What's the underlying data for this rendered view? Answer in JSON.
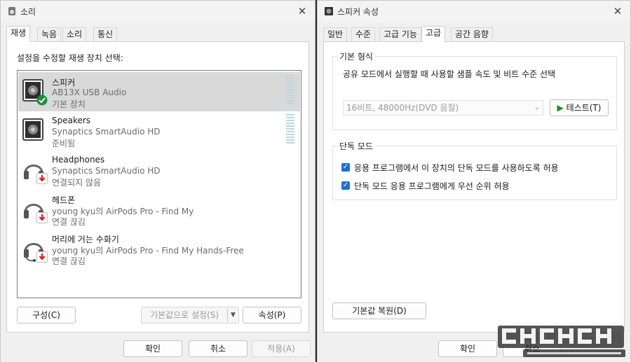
{
  "left_window": {
    "title": "소리",
    "close_glyph": "✕",
    "tabs": [
      "재생",
      "녹음",
      "소리",
      "통신"
    ],
    "active_tab": "재생",
    "prompt": "설정을 수정할 재생 장치 선택:",
    "devices": [
      {
        "name": "스피커",
        "line1": "AB13X USB Audio",
        "line2": "기본 장치",
        "icon": "speaker-icon",
        "status": "default-check",
        "selected": true
      },
      {
        "name": "Speakers",
        "line1": "Synaptics SmartAudio HD",
        "line2": "준비됨",
        "icon": "speaker-icon",
        "status": "none",
        "selected": false
      },
      {
        "name": "Headphones",
        "line1": "Synaptics SmartAudio HD",
        "line2": "연결되지 않음",
        "icon": "headphones-icon",
        "status": "disconnected",
        "selected": false
      },
      {
        "name": "헤드폰",
        "line1": "young kyu의 AirPods Pro - Find My",
        "line2": "연결 끊김",
        "icon": "headphones-icon",
        "status": "disconnected",
        "selected": false
      },
      {
        "name": "머리에 거는 수화기",
        "line1": "young kyu의 AirPods Pro - Find My Hands-Free",
        "line2": "연결 끊김",
        "icon": "headset-icon",
        "status": "disconnected",
        "selected": false
      }
    ],
    "buttons": {
      "configure": "구성(C)",
      "set_default": "기본값으로 설정(S)",
      "properties": "속성(P)",
      "ok": "확인",
      "cancel": "취소",
      "apply": "적용(A)"
    }
  },
  "right_window": {
    "title": "스피커 속성",
    "close_glyph": "✕",
    "tabs": [
      "일반",
      "수준",
      "고급 기능",
      "고급",
      "공간 음향"
    ],
    "active_tab": "고급",
    "default_format": {
      "label": "기본 형식",
      "description": "공유 모드에서 실행할 때 사용할 샘플 속도 및 비트 수준 선택",
      "selected": "16비트, 48000Hz(DVD 음질)",
      "test_label": "테스트(T)"
    },
    "exclusive_mode": {
      "label": "단독 모드",
      "options": [
        {
          "label": "응용 프로그램에서 이 장치의 단독 모드를 사용하도록 허용",
          "checked": true
        },
        {
          "label": "단독 모드 응용 프로그램에게 우선 순위 허용",
          "checked": true
        }
      ]
    },
    "buttons": {
      "restore_defaults": "기본값 복원(D)",
      "ok": "확인",
      "cancel": "취소"
    }
  },
  "colors": {
    "accent": "#1f6fd0",
    "check_green": "#1e8f3a",
    "disconnected_red": "#d81e1e",
    "play_green": "#1f8a1f"
  }
}
